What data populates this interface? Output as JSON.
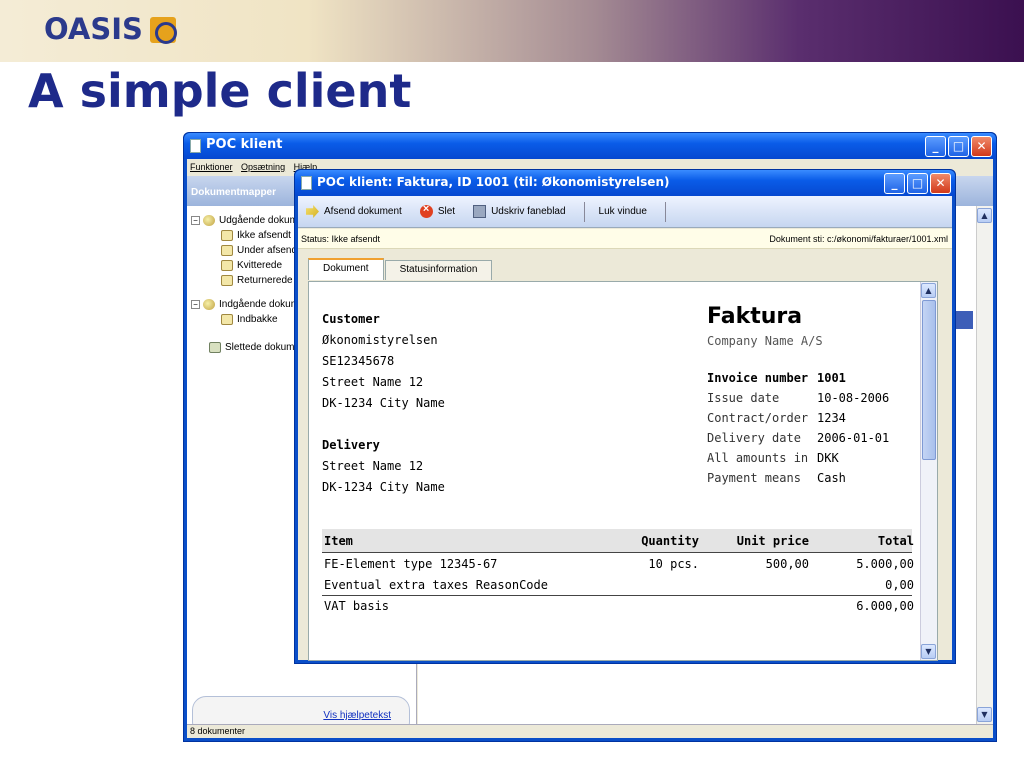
{
  "slide": {
    "logo_text": "OASIS",
    "title": "A simple client"
  },
  "main_window": {
    "title": "POC klient",
    "menu": [
      "Funktioner",
      "Opsætning",
      "Hjælp"
    ],
    "sidebar_header": "Dokumentmapper",
    "tree": [
      {
        "label": "Udgående dokumenter",
        "icon": "globe-icon",
        "expanded": true
      },
      {
        "label": "Ikke afsendt",
        "icon": "folder-icon"
      },
      {
        "label": "Under afsendelse",
        "icon": "folder-icon"
      },
      {
        "label": "Kvitterede",
        "icon": "folder-icon"
      },
      {
        "label": "Returnerede",
        "icon": "folder-icon"
      },
      {
        "label": "Indgående dokumenter",
        "icon": "globe-icon",
        "expanded": true
      },
      {
        "label": "Indbakke",
        "icon": "folder-icon"
      },
      {
        "label": "Slettede dokumenter",
        "icon": "trash-icon"
      }
    ],
    "help_link": "Vis hjælpetekst",
    "status": "8 dokumenter"
  },
  "invoice_window": {
    "title": "POC klient: Faktura, ID 1001 (til: Økonomistyrelsen)",
    "toolbar": {
      "send": "Afsend dokument",
      "delete": "Slet",
      "print": "Udskriv faneblad",
      "close": "Luk vindue"
    },
    "status_text": "Status: Ikke afsendt",
    "path_text": "Dokument sti: c:/økonomi/fakturaer/1001.xml",
    "tabs": [
      "Dokument",
      "Statusinformation"
    ],
    "document": {
      "customer_heading": "Customer",
      "customer": [
        "Økonomistyrelsen",
        "SE12345678",
        "Street Name 12",
        "DK-1234 City Name"
      ],
      "delivery_heading": "Delivery",
      "delivery": [
        "Street Name 12",
        "DK-1234 City Name"
      ],
      "doc_title": "Faktura",
      "company": "Company Name  A/S",
      "invoice_number_label": "Invoice number",
      "invoice_number": "1001",
      "fields": [
        {
          "label": "Issue date",
          "value": "10-08-2006"
        },
        {
          "label": "Contract/order",
          "value": "1234"
        },
        {
          "label": "Delivery date",
          "value": "2006-01-01"
        },
        {
          "label": "All amounts in",
          "value": "DKK"
        },
        {
          "label": "Payment means",
          "value": "Cash"
        }
      ],
      "table": {
        "headers": [
          "Item",
          "Quantity",
          "Unit price",
          "Total"
        ],
        "rows": [
          [
            "FE-Element type 12345-67",
            "10 pcs.",
            "500,00",
            "5.000,00"
          ],
          [
            "Eventual extra taxes ReasonCode",
            "",
            "",
            "0,00"
          ]
        ],
        "vat_basis_label": "VAT basis",
        "vat_basis_value": "6.000,00"
      }
    }
  }
}
